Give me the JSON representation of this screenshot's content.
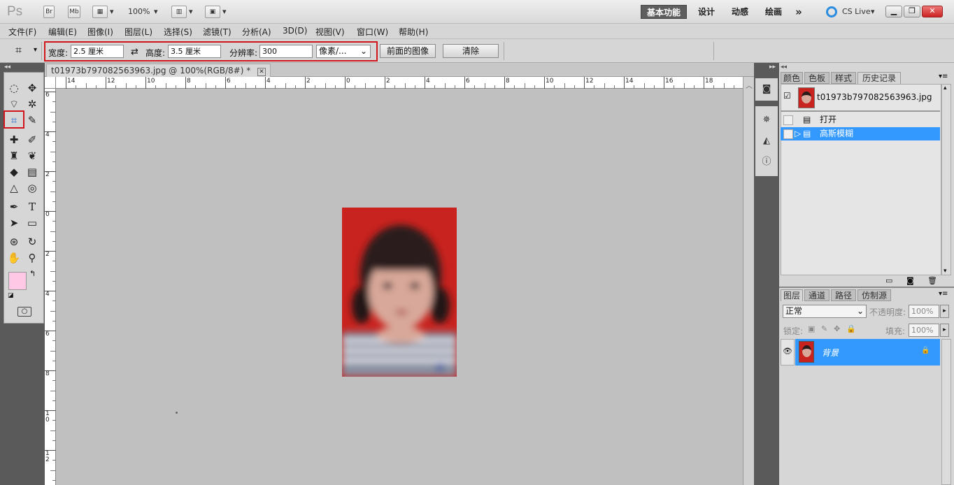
{
  "app": {
    "logo": "Ps"
  },
  "titlebar": {
    "bridge_btn": "Br",
    "minibridge_btn": "Mb",
    "zoom": "100%",
    "workspaces": [
      "基本功能",
      "设计",
      "动感",
      "绘画"
    ],
    "more": "»",
    "cslive": "CS Live"
  },
  "menu": [
    "文件(F)",
    "编辑(E)",
    "图像(I)",
    "图层(L)",
    "选择(S)",
    "滤镜(T)",
    "分析(A)",
    "3D(D)",
    "视图(V)",
    "窗口(W)",
    "帮助(H)"
  ],
  "options": {
    "width_label": "宽度:",
    "width_value": "2.5 厘米",
    "height_label": "高度:",
    "height_value": "3.5 厘米",
    "resolution_label": "分辨率:",
    "resolution_value": "300",
    "unit": "像素/...",
    "front_image_btn": "前面的图像",
    "clear_btn": "清除"
  },
  "document": {
    "tab_title": "t01973b797082563963.jpg @ 100%(RGB/8#) *",
    "ruler_top_labels": [
      "14",
      "12",
      "10",
      "8",
      "6",
      "4",
      "2",
      "0",
      "2",
      "4",
      "6",
      "8",
      "10",
      "12",
      "14",
      "16",
      "18"
    ],
    "ruler_left_labels": [
      "6",
      "4",
      "2",
      "0",
      "2",
      "4",
      "6",
      "8",
      "10",
      "12"
    ]
  },
  "history": {
    "tabs": [
      "颜色",
      "色板",
      "样式",
      "历史记录"
    ],
    "active_tab": "历史记录",
    "snapshot": "t01973b797082563963.jpg",
    "items": [
      "打开",
      "高斯模糊"
    ]
  },
  "layers": {
    "tabs": [
      "图层",
      "通道",
      "路径",
      "仿制源"
    ],
    "blend_mode": "正常",
    "opacity_label": "不透明度:",
    "opacity_value": "100%",
    "lock_label": "锁定:",
    "fill_label": "填充:",
    "fill_value": "100%",
    "layer_name": "背景"
  },
  "colors": {
    "accent": "#3399ff",
    "highlight_box": "#d0161a",
    "foreground": "#ffc8e4",
    "photo_bg": "#c8231f"
  }
}
